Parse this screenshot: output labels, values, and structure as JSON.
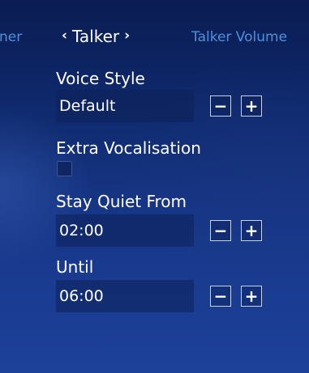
{
  "tabs": {
    "previous_label": "ner",
    "current_label": "Talker",
    "next_label": "Talker Volume",
    "prev_chevron": "‹",
    "next_chevron": "›"
  },
  "settings": {
    "voice_style": {
      "label": "Voice Style",
      "value": "Default"
    },
    "extra_vocalisation": {
      "label": "Extra Vocalisation",
      "checked": false
    },
    "stay_quiet_from": {
      "label": "Stay Quiet From",
      "value": "02:00"
    },
    "until": {
      "label": "Until",
      "value": "06:00"
    }
  },
  "stepper": {
    "decrement_glyph": "−",
    "increment_glyph": "+"
  }
}
